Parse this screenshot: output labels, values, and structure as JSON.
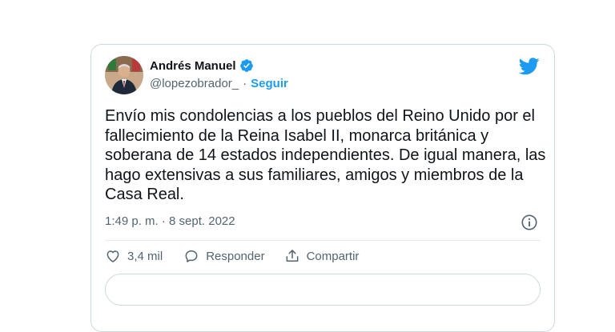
{
  "author": {
    "name": "Andrés Manuel",
    "handle": "@lopezobrador_",
    "separator": "·",
    "follow_label": "Seguir"
  },
  "tweet": {
    "text": "Envío mis condolencias a los pueblos del Reino Unido por el fallecimiento de la Reina Isabel II, monarca británica y soberana de 14 estados independientes. De igual manera, las hago extensivas a sus familiares, amigos y miembros de la Casa Real.",
    "timestamp": "1:49 p. m. · 8 sept. 2022"
  },
  "actions": {
    "like_count": "3,4 mil",
    "reply_label": "Responder",
    "share_label": "Compartir"
  },
  "icons": {
    "verified": "verified-badge-icon",
    "twitter": "twitter-bird-icon",
    "info": "info-icon",
    "like": "heart-icon",
    "reply": "comment-icon",
    "share": "share-icon"
  },
  "colors": {
    "accent": "#1d9bf0",
    "text": "#0f1419",
    "secondary": "#536471",
    "border": "#cfd9de"
  }
}
